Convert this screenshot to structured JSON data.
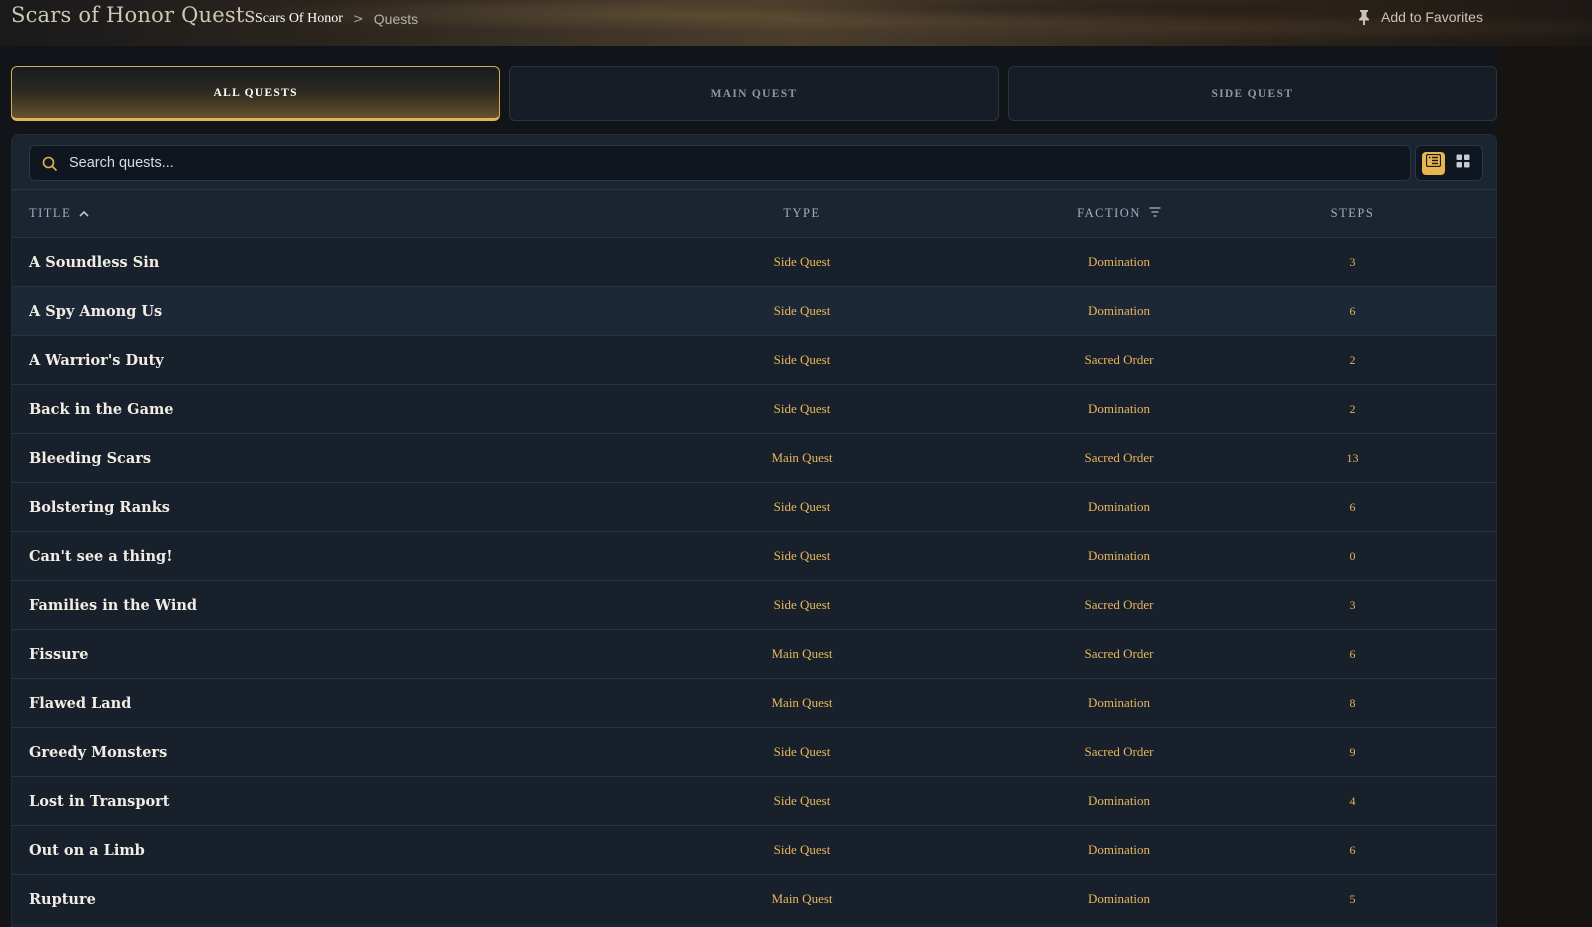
{
  "header": {
    "title": "Scars of Honor Quests",
    "breadcrumb": {
      "home": "Scars Of Honor",
      "separator": ">",
      "current": "Quests"
    },
    "favorites_label": "Add to Favorites"
  },
  "tabs": [
    {
      "label": "ALL QUESTS",
      "active": true
    },
    {
      "label": "MAIN QUEST",
      "active": false
    },
    {
      "label": "SIDE QUEST",
      "active": false
    }
  ],
  "search": {
    "placeholder": "Search quests...",
    "value": ""
  },
  "view_toggle": {
    "selected": "list"
  },
  "table": {
    "headers": {
      "title": "TITLE",
      "type": "TYPE",
      "faction": "FACTION",
      "steps": "STEPS"
    },
    "sort": {
      "column": "title",
      "direction": "ascending"
    },
    "rows": [
      {
        "title": "A Soundless Sin",
        "type": "Side Quest",
        "faction": "Domination",
        "steps": "3"
      },
      {
        "title": "A Spy Among Us",
        "type": "Side Quest",
        "faction": "Domination",
        "steps": "6"
      },
      {
        "title": "A Warrior's Duty",
        "type": "Side Quest",
        "faction": "Sacred Order",
        "steps": "2"
      },
      {
        "title": "Back in the Game",
        "type": "Side Quest",
        "faction": "Domination",
        "steps": "2"
      },
      {
        "title": "Bleeding Scars",
        "type": "Main Quest",
        "faction": "Sacred Order",
        "steps": "13"
      },
      {
        "title": "Bolstering Ranks",
        "type": "Side Quest",
        "faction": "Domination",
        "steps": "6"
      },
      {
        "title": "Can't see a thing!",
        "type": "Side Quest",
        "faction": "Domination",
        "steps": "0"
      },
      {
        "title": "Families in the Wind",
        "type": "Side Quest",
        "faction": "Sacred Order",
        "steps": "3"
      },
      {
        "title": "Fissure",
        "type": "Main Quest",
        "faction": "Sacred Order",
        "steps": "6"
      },
      {
        "title": "Flawed Land",
        "type": "Main Quest",
        "faction": "Domination",
        "steps": "8"
      },
      {
        "title": "Greedy Monsters",
        "type": "Side Quest",
        "faction": "Sacred Order",
        "steps": "9"
      },
      {
        "title": "Lost in Transport",
        "type": "Side Quest",
        "faction": "Domination",
        "steps": "4"
      },
      {
        "title": "Out on a Limb",
        "type": "Side Quest",
        "faction": "Domination",
        "steps": "6"
      },
      {
        "title": "Rupture",
        "type": "Main Quest",
        "faction": "Domination",
        "steps": "5"
      }
    ]
  },
  "colors": {
    "accent_gold": "#e7b64c",
    "cell_text": "#e8b65a",
    "title_text": "#f2ede4",
    "panel_bg": "#18202b"
  },
  "icons": {
    "breadcrumb_separator": "chevron-right-icon",
    "favorites": "pin-icon",
    "search": "search-icon",
    "sort": "sort-ascending-icon",
    "filter": "filter-icon",
    "list_view": "list-view-icon",
    "grid_view": "grid-view-icon"
  }
}
